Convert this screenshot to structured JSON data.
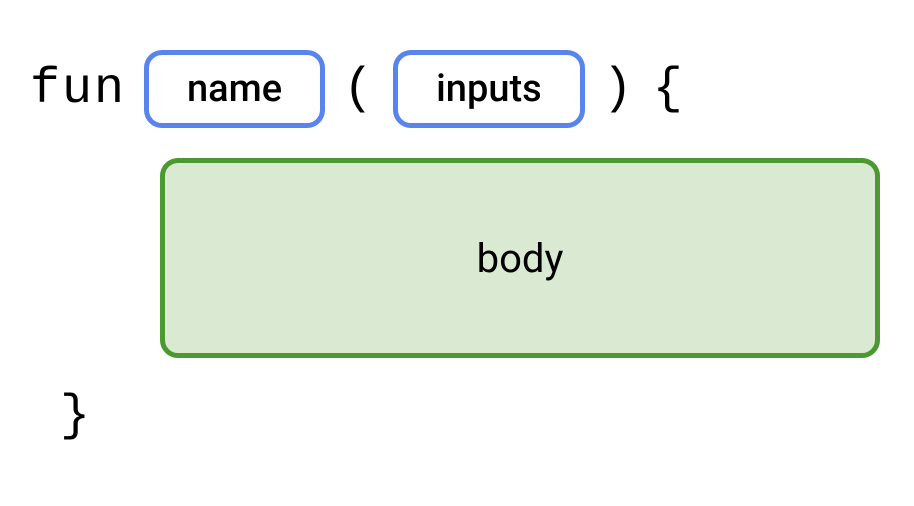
{
  "keyword_fun": "fun",
  "placeholder_name": "name",
  "paren_open": "(",
  "placeholder_inputs": "inputs",
  "paren_close": ")",
  "brace_open": "{",
  "placeholder_body": "body",
  "brace_close": "}"
}
